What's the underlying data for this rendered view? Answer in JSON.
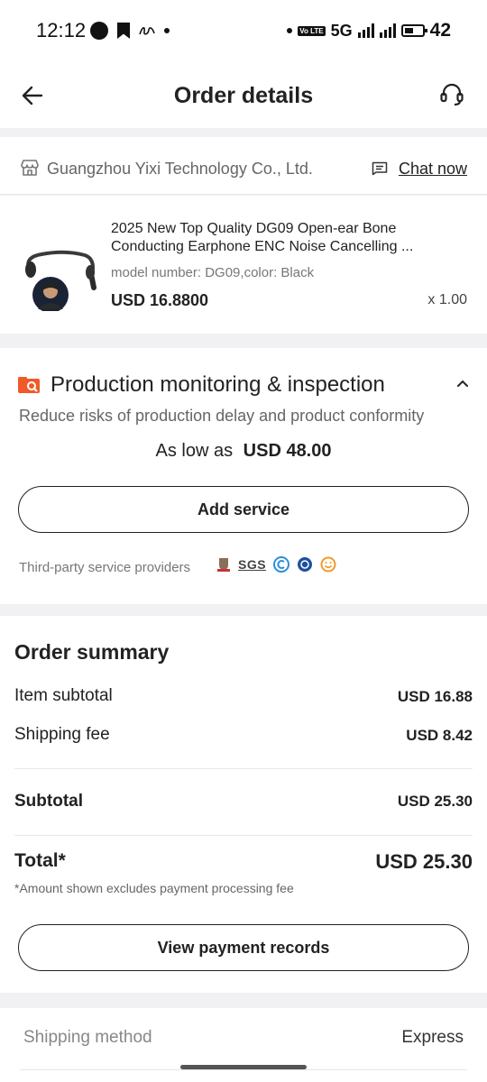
{
  "status_bar": {
    "time": "12:12",
    "volte": "Vo LTE",
    "network": "5G",
    "battery": "42"
  },
  "header": {
    "title": "Order details"
  },
  "supplier": {
    "name": "Guangzhou Yixi Technology Co., Ltd.",
    "chat_label": "Chat now"
  },
  "product": {
    "title": "2025 New Top Quality DG09 Open-ear Bone Conducting Earphone ENC Noise Cancelling ...",
    "spec": "model number: DG09,color: Black",
    "price": "USD 16.8800",
    "quantity": "x 1.00"
  },
  "inspection": {
    "title": "Production monitoring & inspection",
    "description": "Reduce risks of production delay and product conformity",
    "as_low_as_label": "As low as",
    "as_low_as_price": "USD 48.00",
    "add_service_label": "Add service",
    "providers_label": "Third-party service providers",
    "provider_sgs": "SGS",
    "accent_color": "#f05a28"
  },
  "summary": {
    "title": "Order summary",
    "item_subtotal_label": "Item subtotal",
    "item_subtotal_value": "USD 16.88",
    "shipping_fee_label": "Shipping fee",
    "shipping_fee_value": "USD 8.42",
    "subtotal_label": "Subtotal",
    "subtotal_value": "USD 25.30",
    "total_label": "Total*",
    "total_value": "USD 25.30",
    "total_note": "*Amount shown excludes payment processing fee",
    "view_payments_label": "View payment records"
  },
  "shipping": {
    "method_label": "Shipping method",
    "method_value": "Express"
  }
}
